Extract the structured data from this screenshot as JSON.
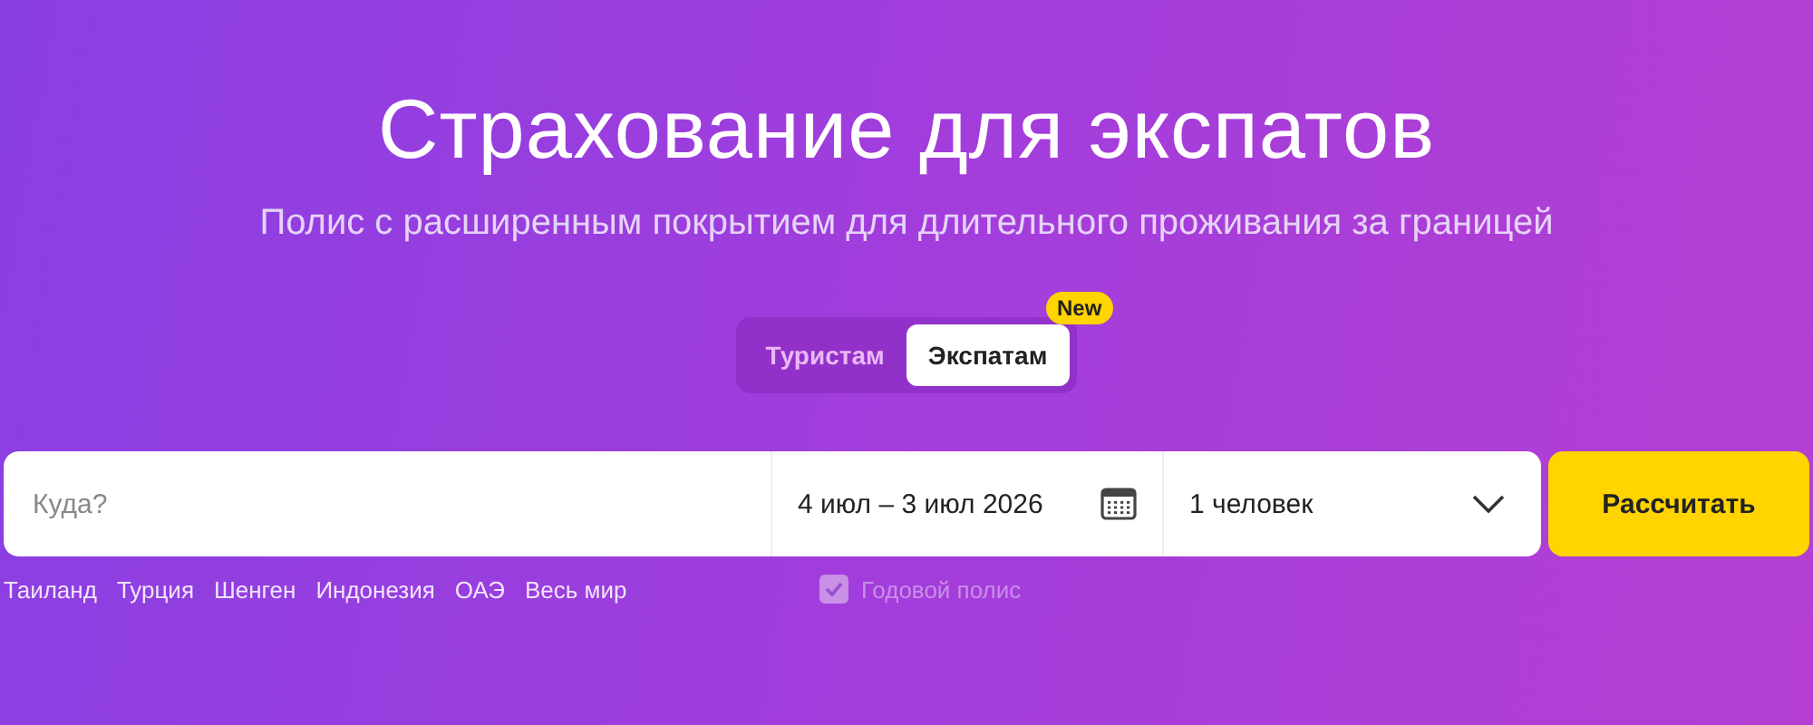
{
  "title": "Страхование для экспатов",
  "subtitle": "Полис с расширенным покрытием для длительного проживания за границей",
  "tabs": [
    {
      "label": "Туристам",
      "selected": false
    },
    {
      "label": "Экспатам",
      "selected": true,
      "badge": "New"
    }
  ],
  "search": {
    "destination": {
      "placeholder": "Куда?"
    },
    "dates": "4 июл – 3 июл 2026",
    "travelers": "1 человек",
    "button": "Рассчитать"
  },
  "quick_links": [
    "Таиланд",
    "Турция",
    "Шенген",
    "Индонезия",
    "ОАЭ",
    "Весь мир"
  ],
  "annual_policy": {
    "label": "Годовой полис",
    "checked": true,
    "disabled": true
  }
}
